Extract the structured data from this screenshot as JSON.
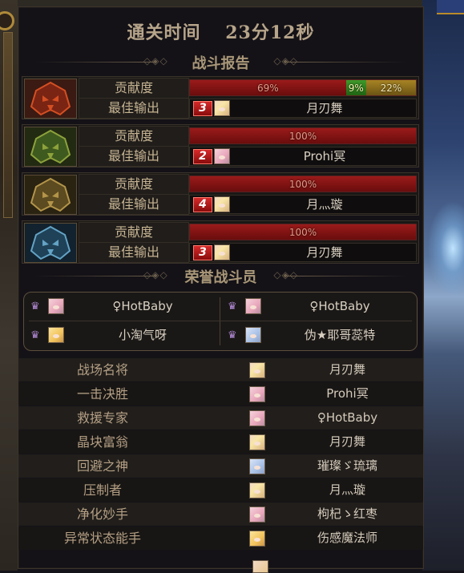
{
  "header": {
    "title": "通关时间",
    "time": "23分12秒"
  },
  "sections": {
    "report": "战斗报告",
    "honor": "荣誉战斗员"
  },
  "labels": {
    "contribution": "贡献度",
    "best_output": "最佳输出"
  },
  "report_rows": [
    {
      "icon": "fire-demon-icon",
      "segments": [
        {
          "value": "69%",
          "color": "red",
          "fraction": 0.69
        },
        {
          "value": "9%",
          "color": "green",
          "fraction": 0.09
        },
        {
          "value": "22%",
          "color": "gold",
          "fraction": 0.22
        }
      ],
      "rank": "3",
      "best_player": "月刃舞"
    },
    {
      "icon": "green-demon-icon",
      "segments": [
        {
          "value": "100%",
          "color": "red",
          "fraction": 1.0
        }
      ],
      "rank": "2",
      "best_player": "Prohi冥"
    },
    {
      "icon": "gold-demon-icon",
      "segments": [
        {
          "value": "100%",
          "color": "red",
          "fraction": 1.0
        }
      ],
      "rank": "4",
      "best_player": "月灬璇"
    },
    {
      "icon": "ice-demon-icon",
      "segments": [
        {
          "value": "100%",
          "color": "red",
          "fraction": 1.0
        }
      ],
      "rank": "3",
      "best_player": "月刃舞"
    }
  ],
  "honor_members": [
    {
      "name": "♀HotBaby"
    },
    {
      "name": "♀HotBaby"
    },
    {
      "name": "小淘气呀"
    },
    {
      "name": "伪★耶哥蕊特"
    }
  ],
  "awards": [
    {
      "title": "战场名将",
      "player": "月刃舞"
    },
    {
      "title": "一击决胜",
      "player": "Prohi冥"
    },
    {
      "title": "救援专家",
      "player": "♀HotBaby"
    },
    {
      "title": "晶块富翁",
      "player": "月刃舞"
    },
    {
      "title": "回避之神",
      "player": "璀璨ゞ琉璃"
    },
    {
      "title": "压制者",
      "player": "月灬璇"
    },
    {
      "title": "净化妙手",
      "player": "枸杞ゝ红枣"
    },
    {
      "title": "异常状态能手",
      "player": "伤感魔法师"
    }
  ],
  "colors": {
    "bar_red": "#8b1414",
    "bar_green": "#2f8a21",
    "bar_gold": "#9a7a20",
    "text_gold": "#c6b493"
  }
}
